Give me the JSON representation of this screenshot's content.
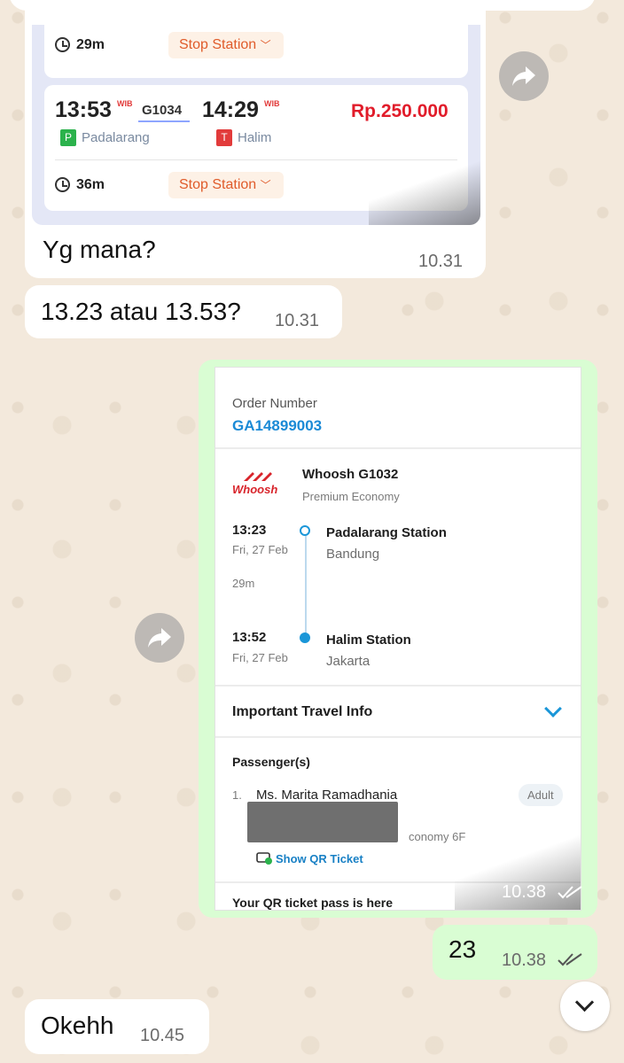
{
  "chat": {
    "train_card_prev": {
      "duration": "29m",
      "stop_label": "Stop Station"
    },
    "train_card": {
      "dep_time": "13:53",
      "dep_tz": "WIB",
      "train_no": "G1034",
      "arr_time": "14:29",
      "arr_tz": "WIB",
      "price": "Rp.250.000",
      "from_code": "P",
      "from_name": "Padalarang",
      "to_code": "T",
      "to_name": "Halim",
      "duration": "36m",
      "stop_label": "Stop Station"
    },
    "msg1": {
      "text": "Yg mana?",
      "time": "10.31"
    },
    "msg2": {
      "text": "13.23 atau 13.53?",
      "time": "10.31"
    },
    "order": {
      "order_label": "Order Number",
      "order_number": "GA14899003",
      "logo_text": "Whoosh",
      "train_title": "Whoosh G1032",
      "class": "Premium Economy",
      "dep_time": "13:23",
      "dep_date": "Fri, 27 Feb",
      "dep_station": "Padalarang Station",
      "dep_city": "Bandung",
      "duration": "29m",
      "arr_time": "13:52",
      "arr_date": "Fri, 27 Feb",
      "arr_station": "Halim Station",
      "arr_city": "Jakarta",
      "important_info": "Important Travel Info",
      "passengers_label": "Passenger(s)",
      "passenger_index": "1.",
      "passenger_name": "Ms. Marita Ramadhania",
      "passenger_type": "Adult",
      "seat_info": "conomy 6F",
      "qr_link": "Show QR Ticket",
      "qr_pass": "Your QR ticket pass is here",
      "time": "10.38"
    },
    "msg3": {
      "text": "23",
      "time": "10.38"
    },
    "msg4": {
      "text": "Okehh",
      "time": "10.45"
    }
  },
  "colors": {
    "outgoing_bubble": "#d9fdd3",
    "incoming_bubble": "#ffffff",
    "wallpaper": "#f3e9dc",
    "price_red": "#e11c2a",
    "link_blue": "#1b8ad6"
  },
  "icons": [
    "clock-icon",
    "forward-icon",
    "chevron-down-icon",
    "double-check-icon",
    "qr-ticket-icon",
    "scroll-down-icon"
  ]
}
